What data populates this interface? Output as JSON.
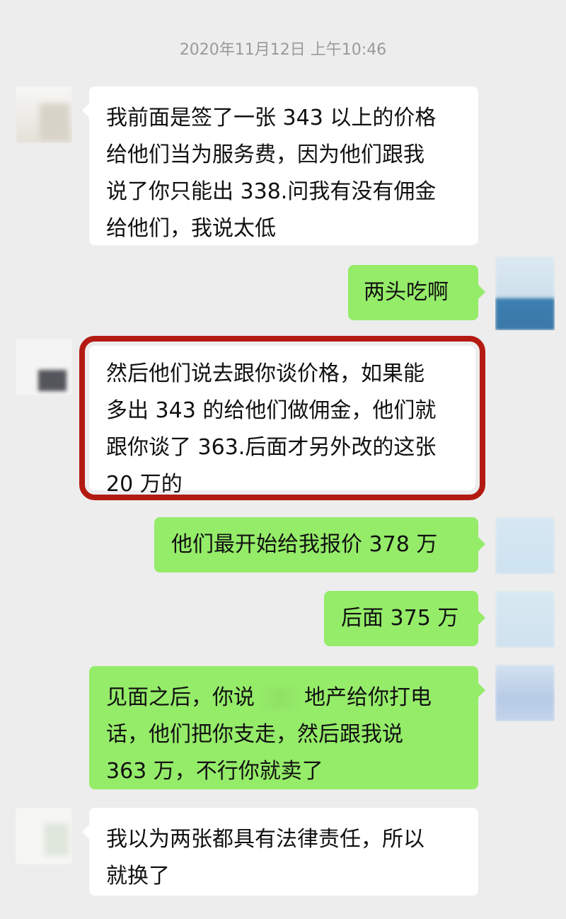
{
  "header": {
    "timestamp": "2020年11月12日 上午10:46"
  },
  "messages": [
    {
      "direction": "in",
      "lines": [
        "我前面是签了一张 343 以上的价格",
        "给他们当为服务费，因为他们跟我",
        "说了你只能出 338.问我有没有佣金",
        "给他们，我说太低"
      ]
    },
    {
      "direction": "out",
      "lines": [
        "两头吃啊"
      ]
    },
    {
      "direction": "in",
      "highlighted": true,
      "lines": [
        "然后他们说去跟你谈价格，如果能",
        "多出 343 的给他们做佣金，他们就",
        "跟你谈了 363.后面才另外改的这张",
        "20 万的"
      ]
    },
    {
      "direction": "out",
      "lines": [
        "他们最开始给我报价 378 万"
      ]
    },
    {
      "direction": "out",
      "lines": [
        "后面 375 万"
      ]
    },
    {
      "direction": "out",
      "lines_before_redaction": "见面之后，你说",
      "lines_after_redaction": "地产给你打电",
      "lines": [
        "话，他们把你支走，然后跟我说",
        "363 万，不行你就卖了"
      ]
    },
    {
      "direction": "in",
      "lines": [
        "我以为两张都具有法律责任，所以",
        "就换了"
      ]
    }
  ],
  "colors": {
    "background": "#ededed",
    "incoming_bubble": "#ffffff",
    "outgoing_bubble": "#95ec69",
    "highlight_border": "#b31a12",
    "timestamp_text": "#9a9a9a"
  },
  "icons": [
    "avatar-blurred"
  ]
}
